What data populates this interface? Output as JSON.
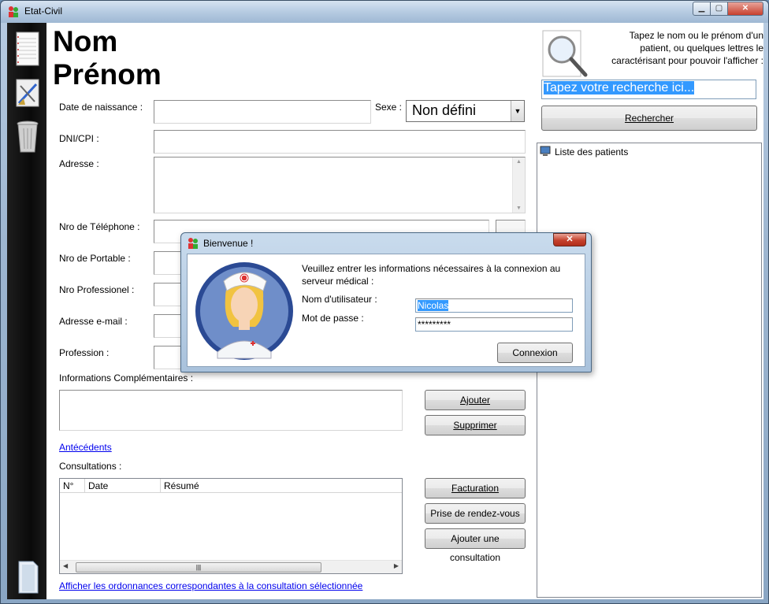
{
  "window": {
    "title": "Etat-Civil",
    "controls": {
      "minimize": "▁",
      "maximize": "▢",
      "close": "✕"
    }
  },
  "left_toolbar": {
    "items": [
      {
        "name": "notebook-icon"
      },
      {
        "name": "drawing-tools-icon"
      },
      {
        "name": "trash-icon"
      },
      {
        "name": "document-icon"
      }
    ]
  },
  "form": {
    "nom": "Nom",
    "prenom": "Prénom",
    "labels": {
      "date_naissance": "Date de naissance :",
      "sexe": "Sexe :",
      "dni": "DNI/CPI :",
      "adresse": "Adresse :",
      "telephone": "Nro de Téléphone :",
      "portable": "Nro de Portable :",
      "professionel": "Nro Professionel :",
      "email": "Adresse e-mail :",
      "profession": "Profession :",
      "infos": "Informations Complémentaires :",
      "consultations": "Consultations :"
    },
    "sexe_value": "Non défini",
    "buttons": {
      "ajouter": "Ajouter",
      "supprimer": "Supprimer",
      "facturation": "Facturation",
      "rendez_vous": "Prise de rendez-vous",
      "ajouter_consultation": "Ajouter une consultation"
    },
    "links": {
      "antecedents": "Antécédents",
      "ordonnances": "Afficher les ordonnances correspondantes à la consultation sélectionnée"
    },
    "consultations_columns": [
      "N°",
      "Date",
      "Résumé"
    ],
    "scroll_grip": "|||"
  },
  "search": {
    "help": "Tapez le nom ou le prénom d'un patient, ou quelques lettres le caractérisant pour pouvoir l'afficher :",
    "value": "Tapez votre recherche ici...",
    "button": "Rechercher",
    "tree_root": "Liste des patients"
  },
  "dialog": {
    "title": "Bienvenue !",
    "message": "Veuillez entrer les informations nécessaires à la connexion au serveur médical :",
    "username_label": "Nom d'utilisateur :",
    "password_label": "Mot de passe :",
    "username_value": "Nicolas",
    "password_value": "*********",
    "connect_button": "Connexion"
  },
  "colors": {
    "link": "#0000ee",
    "selection": "#3399ff",
    "sidebar": "#0a0a0a"
  }
}
